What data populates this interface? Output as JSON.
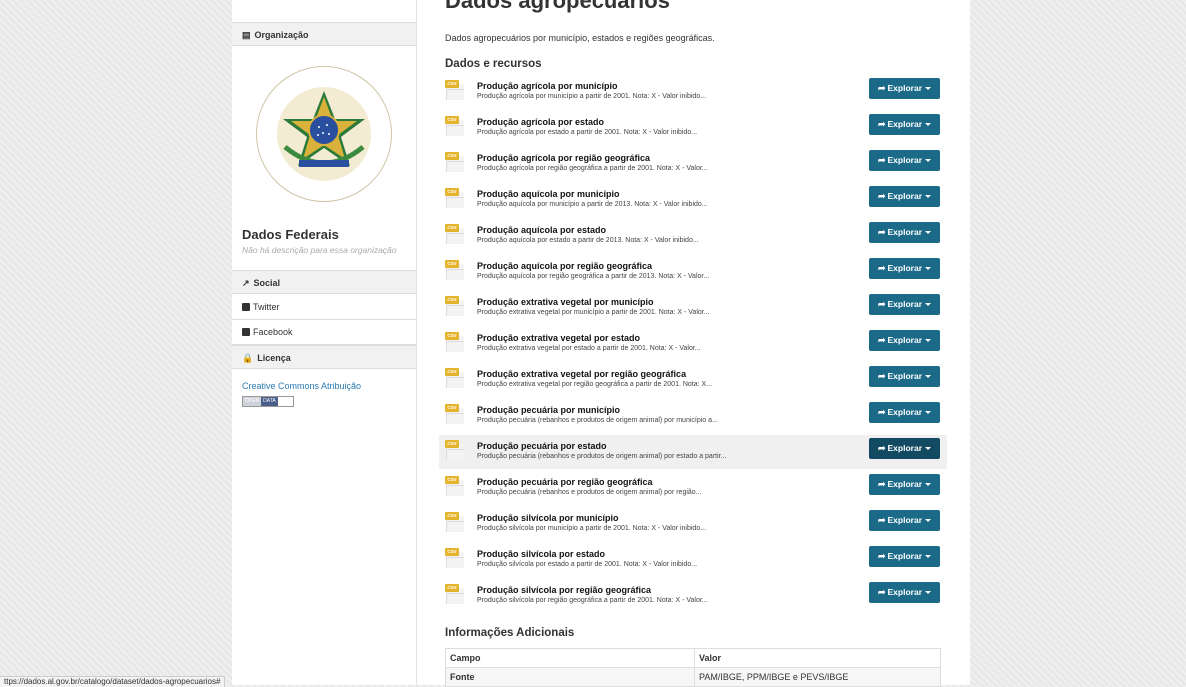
{
  "dataset": {
    "title": "Dados agropecuários",
    "description": "Dados agropecuários por município, estados e regiões geográficas."
  },
  "sidebar": {
    "org_heading": "Organização",
    "org_name": "Dados Federais",
    "org_description": "Não há descrição para essa organização",
    "social_heading": "Social",
    "twitter": "Twitter",
    "facebook": "Facebook",
    "license_heading": "Licença",
    "license_link": "Creative Commons Atribuição",
    "badge_open": "OPEN",
    "badge_data": "DATA"
  },
  "resources_heading": "Dados e recursos",
  "format_label": "CSV",
  "explore_label": "Explorar",
  "resources": [
    {
      "title": "Produção agrícola por município",
      "description": "Produção agrícola por município a partir de 2001. Nota: X - Valor inibido..."
    },
    {
      "title": "Produção agrícola por estado",
      "description": "Produção agrícola por estado a partir de 2001. Nota: X - Valor inibido..."
    },
    {
      "title": "Produção agrícola por região geográfica",
      "description": "Produção agrícola por região geográfica a partir de 2001. Nota: X - Valor..."
    },
    {
      "title": "Produção aquícola por município",
      "description": "Produção aquícola por município a partir de 2013. Nota: X - Valor inibido..."
    },
    {
      "title": "Produção aquícola por estado",
      "description": "Produção aquícola por estado a partir de 2013. Nota: X - Valor inibido..."
    },
    {
      "title": "Produção aquícola por região geográfica",
      "description": "Produção aquícola por região geográfica a partir de 2013. Nota: X - Valor..."
    },
    {
      "title": "Produção extrativa vegetal por município",
      "description": "Produção extrativa vegetal por município a partir de 2001. Nota: X - Valor..."
    },
    {
      "title": "Produção extrativa vegetal por estado",
      "description": "Produção extrativa vegetal por estado a partir de 2001. Nota: X - Valor..."
    },
    {
      "title": "Produção extrativa vegetal por região geográfica",
      "description": "Produção extrativa vegetal por região geográfica a partir de 2001. Nota: X..."
    },
    {
      "title": "Produção pecuária por município",
      "description": "Produção pecuária (rebanhos e produtos de origem animal) por município a..."
    },
    {
      "title": "Produção pecuária por estado",
      "description": "Produção pecuária (rebanhos e produtos de origem animal) por estado a partir..."
    },
    {
      "title": "Produção pecuária por região geográfica",
      "description": "Produção pecuária (rebanhos e produtos de origem animal) por região..."
    },
    {
      "title": "Produção silvícola por município",
      "description": "Produção silvícola por município a partir de 2001. Nota: X - Valor inibido..."
    },
    {
      "title": "Produção silvícola por estado",
      "description": "Produção silvícola por estado a partir de 2001. Nota: X - Valor inibido..."
    },
    {
      "title": "Produção silvícola por região geográfica",
      "description": "Produção silvícola por região geográfica a partir de 2001. Nota: X - Valor..."
    }
  ],
  "additional": {
    "heading": "Informações Adicionais",
    "col_field": "Campo",
    "col_value": "Valor",
    "rows": [
      {
        "field": "Fonte",
        "value": "PAM/IBGE, PPM/IBGE e PEVS/IBGE"
      }
    ]
  },
  "status_url": "ttps://dados.al.gov.br/catalogo/dataset/dados-agropecuarios#",
  "colors": {
    "accent": "#1b6a88",
    "accent_active": "#124a61",
    "csv_tag": "#e4b52c"
  }
}
